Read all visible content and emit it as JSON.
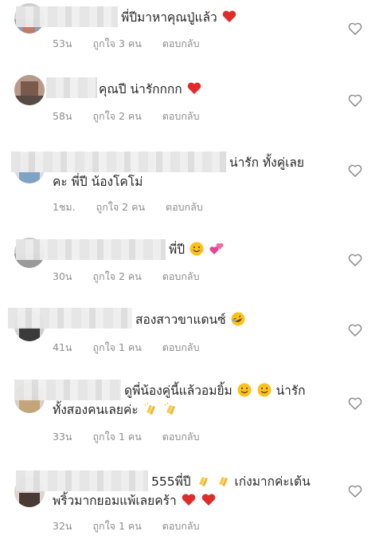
{
  "comments": [
    {
      "text": "พี่ปีมาหาคุณปู่แล้ว",
      "emoji": [
        "red-heart"
      ],
      "time": "53น",
      "likes": "ถูกใจ 3 คน",
      "reply": "ตอบกลับ"
    },
    {
      "text": "คุณปี น่ารักกกก",
      "emoji": [
        "red-heart"
      ],
      "time": "58น",
      "likes": "ถูกใจ 2 คน",
      "reply": "ตอบกลับ"
    },
    {
      "text": "น่ารัก ทั้งคู่เลย",
      "text2": "คะ พี่ปี น้องโคโม่",
      "emoji": [],
      "time": "1ชม.",
      "likes": "ถูกใจ 2 คน",
      "reply": "ตอบกลับ"
    },
    {
      "text": "พี่ปี",
      "emoji": [
        "smiling-face",
        "two-hearts"
      ],
      "time": "30น",
      "likes": "ถูกใจ 2 คน",
      "reply": "ตอบกลับ"
    },
    {
      "text": "สองสาวขาแดนซ์",
      "emoji": [
        "rolling-laughing"
      ],
      "time": "41น",
      "likes": "ถูกใจ 1 คน",
      "reply": "ตอบกลับ"
    },
    {
      "text": "ดูพี่น้องคู่นี้แล้วอมยิ้ม",
      "text_mid": "น่ารัก",
      "text2": "ทั้งสองคนเลยค่ะ",
      "emoji": [
        "smiling-face",
        "smiling-face"
      ],
      "emoji2": [
        "clapping-hands",
        "clapping-hands"
      ],
      "time": "33น",
      "likes": "ถูกใจ 1 คน",
      "reply": "ตอบกลับ"
    },
    {
      "text": "555พี่ปี",
      "text_mid": "เก่งมากค่ะเต้น",
      "text2": "พริ้วมากยอมแพ้เลยคร้า",
      "emoji": [
        "clapping-hands",
        "clapping-hands"
      ],
      "emoji2": [
        "red-heart",
        "red-heart"
      ],
      "time": "32น",
      "likes": "ถูกใจ 1 คน",
      "reply": "ตอบกลับ"
    }
  ],
  "icons": {
    "like": "heart-outline-icon"
  },
  "colors": {
    "text": "#262626",
    "meta": "#8e8e8e",
    "heart": "#e0245e"
  }
}
